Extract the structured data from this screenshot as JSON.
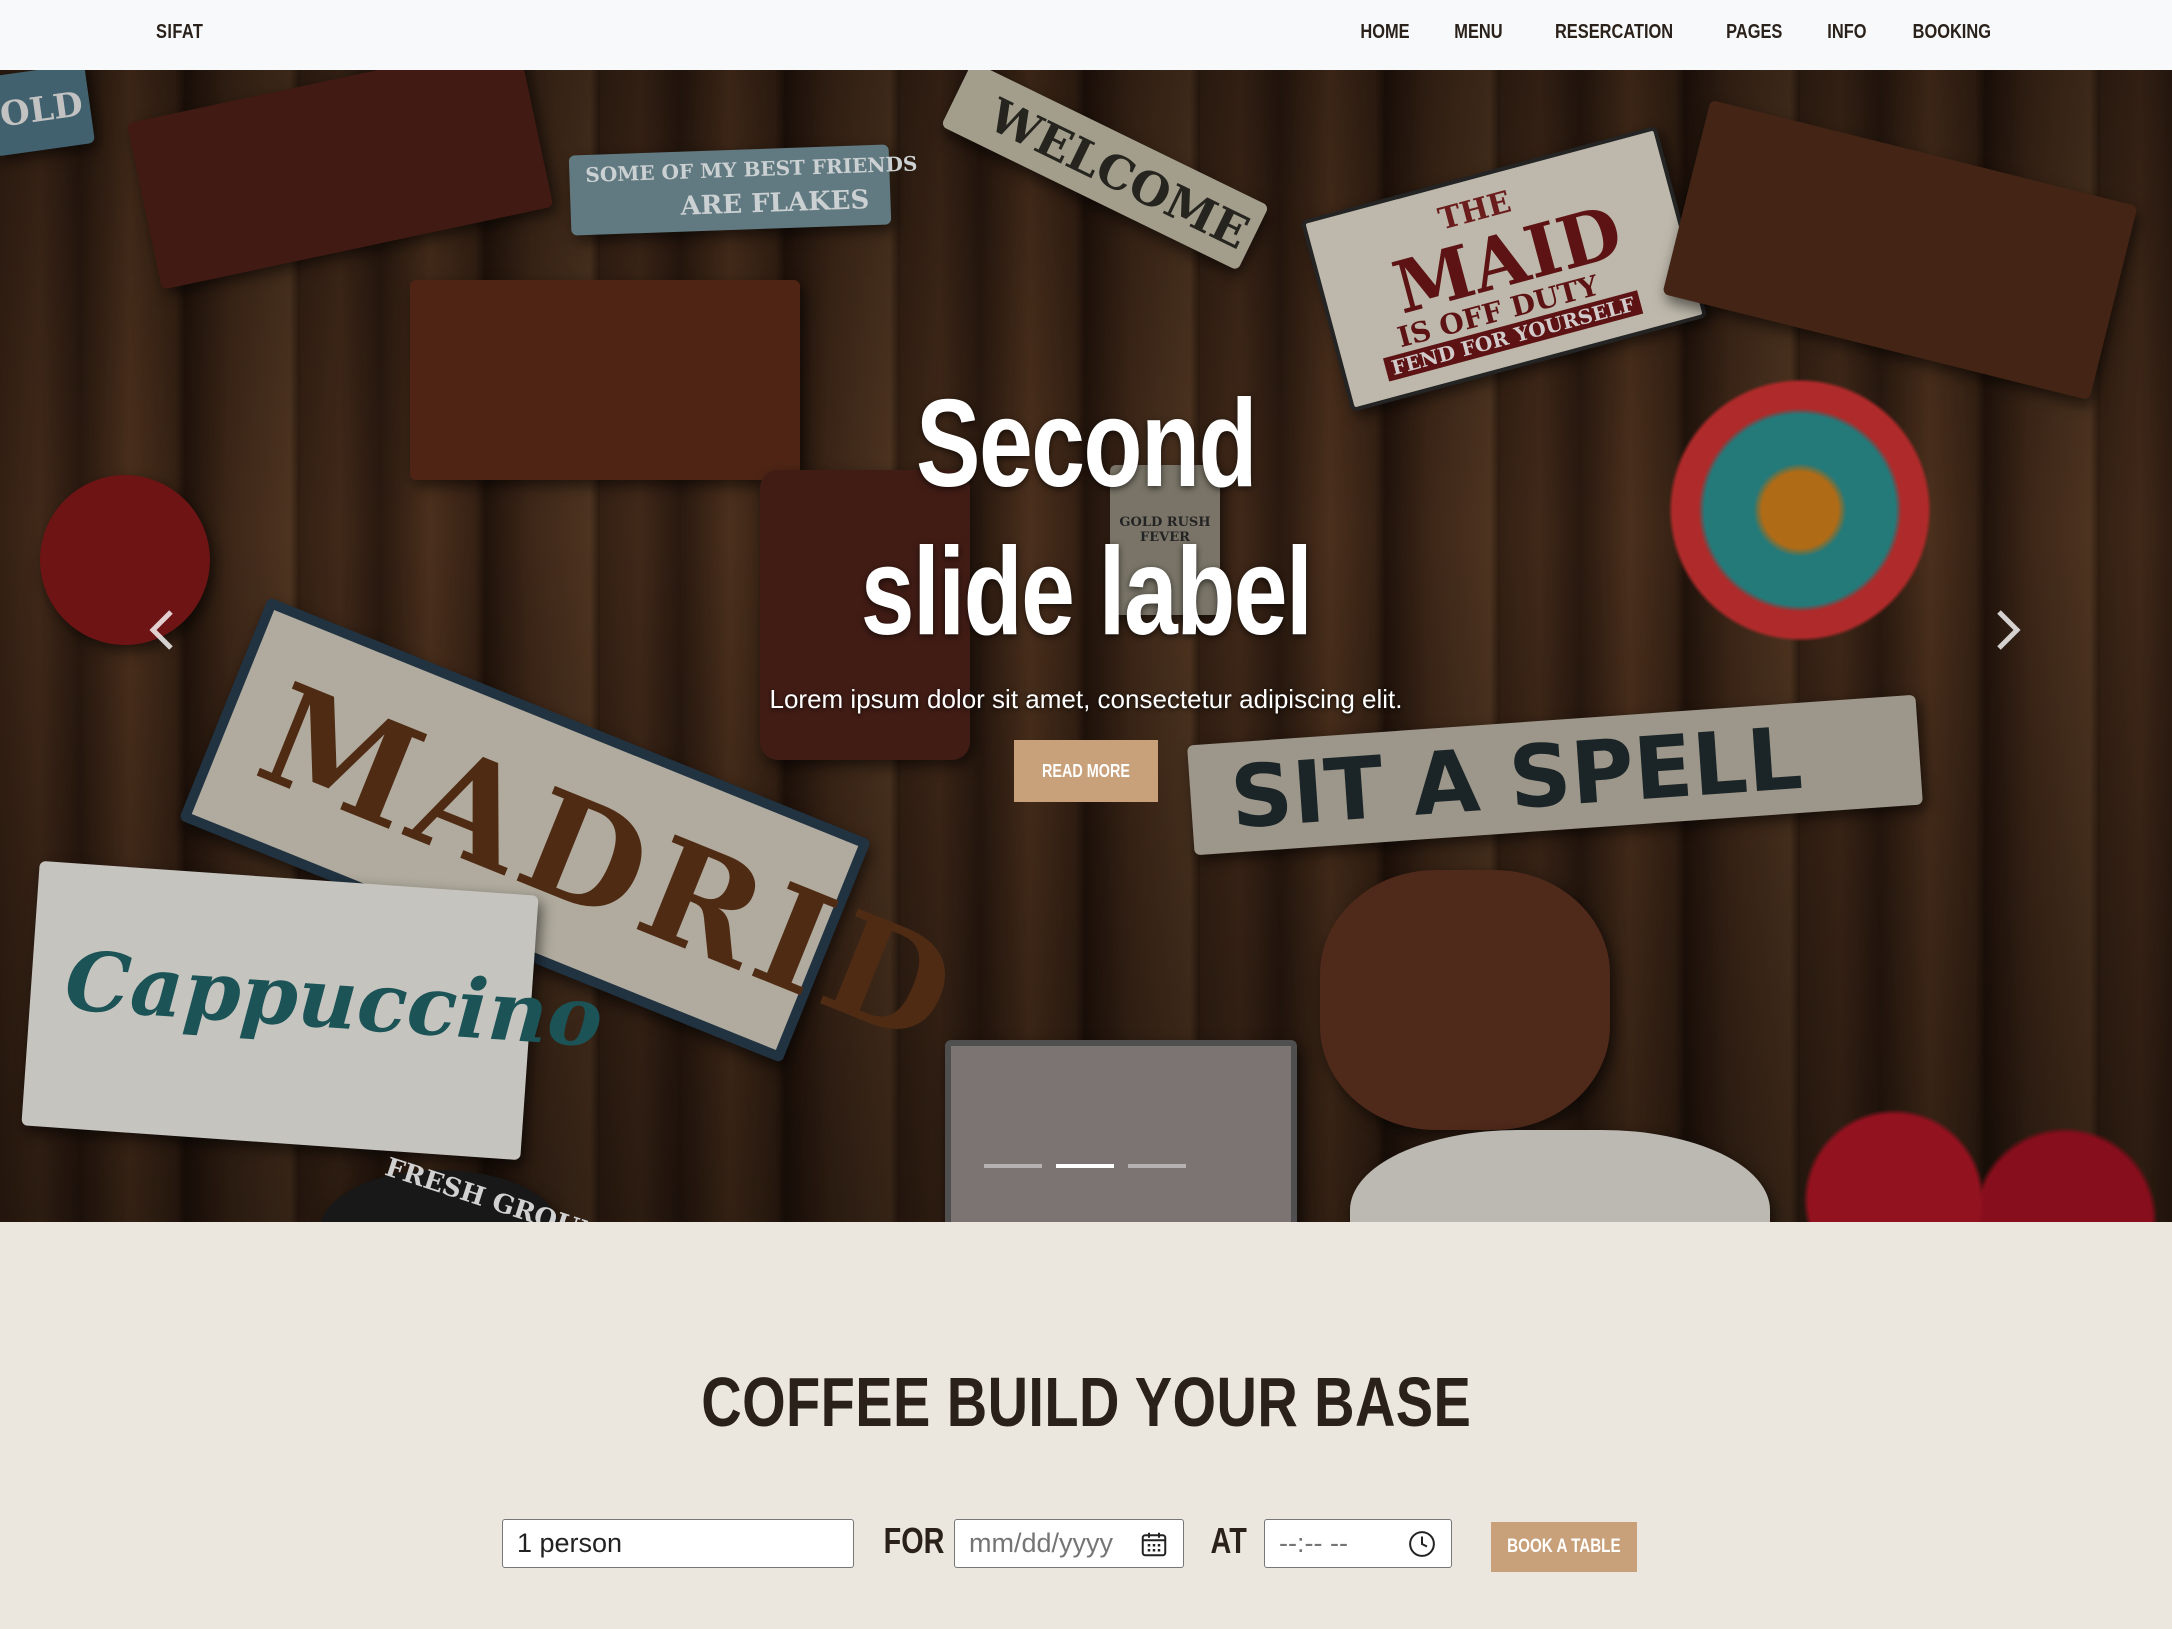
{
  "navbar": {
    "brand": "SIFAT",
    "links": [
      "HOME",
      "MENU",
      "RESERCATION",
      "PAGES",
      "INFO",
      "BOOKING"
    ]
  },
  "hero": {
    "title": "Second slide label",
    "text": "Lorem ipsum dolor sit amet, consectetur adipiscing elit.",
    "button": "READ MORE",
    "signs": {
      "welcome": "WELCOME",
      "madrid": "MADRID",
      "cappuccino": "Cappuccino",
      "spell": "SIT A SPELL",
      "maid_1": "THE",
      "maid_2": "MAID",
      "maid_3": "IS OFF DUTY",
      "maid_4": "FEND FOR YOURSELF",
      "friends_1": "SOME OF MY BEST FRIENDS",
      "friends_2": "ARE FLAKES",
      "fresh": "FRESH GROUND",
      "old": "OLD",
      "gold": "GOLD RUSH FEVER"
    },
    "indicators": 3,
    "active_indicator": 1,
    "prev_icon": "chevron-left-icon",
    "next_icon": "chevron-right-icon"
  },
  "booking": {
    "title": "COFFEE BUILD YOUR BASE",
    "persons_value": "1 person",
    "for_label": "FOR",
    "date_placeholder": "mm/dd/yyyy",
    "at_label": "AT",
    "time_placeholder": "--:-- --",
    "button": "BOOK A TABLE"
  },
  "colors": {
    "accent": "#c8a07a",
    "text_dark": "#2a211b",
    "section_bg": "#ebe7df",
    "navbar_bg": "#f8f9fa"
  }
}
